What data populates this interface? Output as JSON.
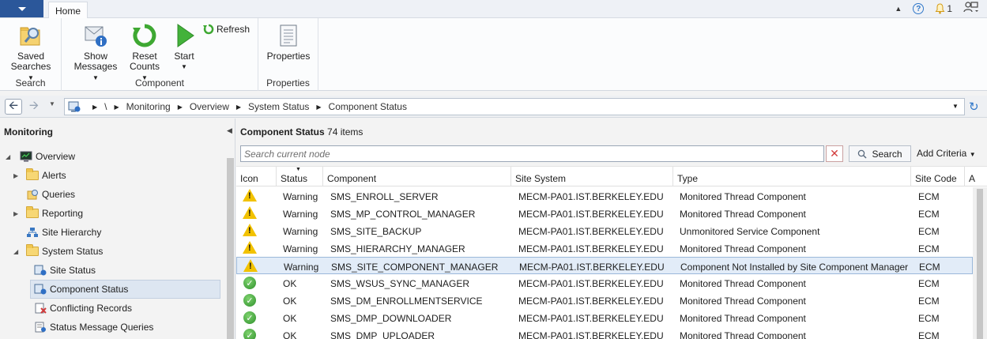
{
  "ribbon": {
    "tab": "Home",
    "notification_count": "1",
    "groups": {
      "search": {
        "label": "Search",
        "saved_searches": [
          "Saved",
          "Searches"
        ]
      },
      "component": {
        "label": "Component",
        "show_messages": [
          "Show",
          "Messages"
        ],
        "reset_counts": [
          "Reset",
          "Counts"
        ],
        "start": "Start",
        "refresh": "Refresh"
      },
      "properties": {
        "label": "Properties",
        "properties_button": "Properties"
      }
    }
  },
  "address": {
    "root": "\\",
    "crumbs": [
      "Monitoring",
      "Overview",
      "System Status",
      "Component Status"
    ]
  },
  "sidebar": {
    "title": "Monitoring",
    "items": [
      {
        "label": "Overview"
      },
      {
        "label": "Alerts"
      },
      {
        "label": "Queries"
      },
      {
        "label": "Reporting"
      },
      {
        "label": "Site Hierarchy"
      },
      {
        "label": "System Status"
      },
      {
        "label": "Site Status"
      },
      {
        "label": "Component Status"
      },
      {
        "label": "Conflicting Records"
      },
      {
        "label": "Status Message Queries"
      }
    ]
  },
  "main": {
    "title": "Component Status",
    "count": "74 items",
    "search_placeholder": "Search current node",
    "search_button": "Search",
    "add_criteria": "Add Criteria",
    "columns": [
      "Icon",
      "Status",
      "Component",
      "Site System",
      "Type",
      "Site Code",
      "A"
    ],
    "rows": [
      {
        "icon": "warning",
        "status": "Warning",
        "component": "SMS_ENROLL_SERVER",
        "site_system": "MECM-PA01.IST.BERKELEY.EDU",
        "type": "Monitored Thread Component",
        "site_code": "ECM"
      },
      {
        "icon": "warning",
        "status": "Warning",
        "component": "SMS_MP_CONTROL_MANAGER",
        "site_system": "MECM-PA01.IST.BERKELEY.EDU",
        "type": "Monitored Thread Component",
        "site_code": "ECM"
      },
      {
        "icon": "warning",
        "status": "Warning",
        "component": "SMS_SITE_BACKUP",
        "site_system": "MECM-PA01.IST.BERKELEY.EDU",
        "type": "Unmonitored Service Component",
        "site_code": "ECM"
      },
      {
        "icon": "warning",
        "status": "Warning",
        "component": "SMS_HIERARCHY_MANAGER",
        "site_system": "MECM-PA01.IST.BERKELEY.EDU",
        "type": "Monitored Thread Component",
        "site_code": "ECM"
      },
      {
        "icon": "warning",
        "status": "Warning",
        "component": "SMS_SITE_COMPONENT_MANAGER",
        "site_system": "MECM-PA01.IST.BERKELEY.EDU",
        "type": "Component Not Installed by Site Component Manager",
        "site_code": "ECM"
      },
      {
        "icon": "ok",
        "status": "OK",
        "component": "SMS_WSUS_SYNC_MANAGER",
        "site_system": "MECM-PA01.IST.BERKELEY.EDU",
        "type": "Monitored Thread Component",
        "site_code": "ECM"
      },
      {
        "icon": "ok",
        "status": "OK",
        "component": "SMS_DM_ENROLLMENTSERVICE",
        "site_system": "MECM-PA01.IST.BERKELEY.EDU",
        "type": "Monitored Thread Component",
        "site_code": "ECM"
      },
      {
        "icon": "ok",
        "status": "OK",
        "component": "SMS_DMP_DOWNLOADER",
        "site_system": "MECM-PA01.IST.BERKELEY.EDU",
        "type": "Monitored Thread Component",
        "site_code": "ECM"
      },
      {
        "icon": "ok",
        "status": "OK",
        "component": "SMS_DMP_UPLOADER",
        "site_system": "MECM-PA01.IST.BERKELEY.EDU",
        "type": "Monitored Thread Component",
        "site_code": "ECM"
      }
    ]
  }
}
